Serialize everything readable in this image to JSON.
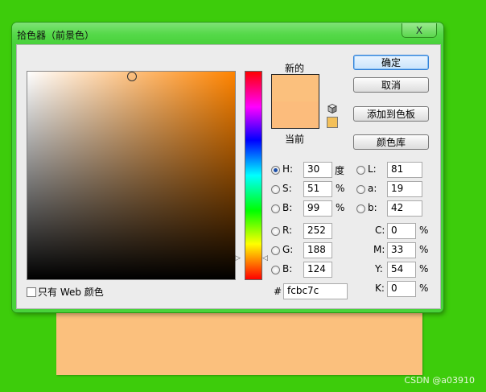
{
  "dialog": {
    "title": "拾色器（前景色）",
    "close_glyph": "X",
    "label_new": "新的",
    "label_current": "当前",
    "new_color": "#fbc07d",
    "current_color": "#fcbc7c",
    "gamut_warning_color": "#f3c05a",
    "base_hue_color": "#ff8400",
    "buttons": {
      "ok": "确定",
      "cancel": "取消",
      "add_to_swatches": "添加到色板",
      "color_libraries": "颜色库"
    },
    "hsb": {
      "h_label": "H:",
      "h_value": "30",
      "h_unit": "度",
      "s_label": "S:",
      "s_value": "51",
      "s_unit": "%",
      "b_label": "B:",
      "b_value": "99",
      "b_unit": "%"
    },
    "rgb": {
      "r_label": "R:",
      "r_value": "252",
      "g_label": "G:",
      "g_value": "188",
      "b_label": "B:",
      "b_value": "124"
    },
    "lab": {
      "l_label": "L:",
      "l_value": "81",
      "a_label": "a:",
      "a_value": "19",
      "b_label": "b:",
      "b_value": "42"
    },
    "cmyk": {
      "c_label": "C:",
      "c_value": "0",
      "c_unit": "%",
      "m_label": "M:",
      "m_value": "33",
      "m_unit": "%",
      "y_label": "Y:",
      "y_value": "54",
      "y_unit": "%",
      "k_label": "K:",
      "k_value": "0",
      "k_unit": "%"
    },
    "hex": {
      "label": "#",
      "value": "fcbc7c"
    },
    "only_web_colors": "只有 Web 颜色"
  },
  "watermark": "CSDN @a03910",
  "background_color": "#3dcc0b"
}
